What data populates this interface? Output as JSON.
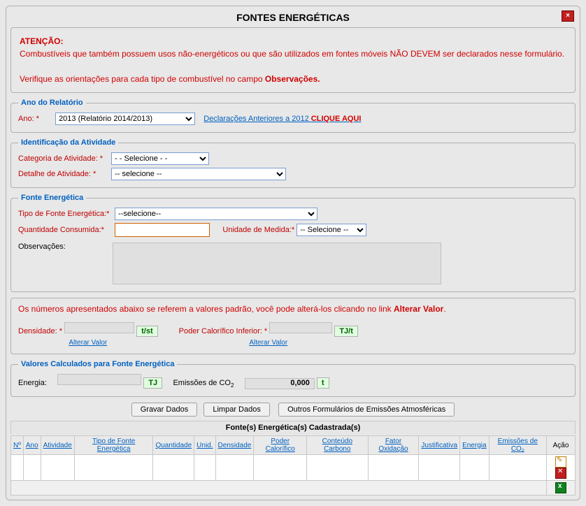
{
  "window": {
    "title": "FONTES ENERGÉTICAS",
    "close": "×"
  },
  "attention": {
    "heading": "ATENÇÃO:",
    "line1": "Combustíveis que também possuem usos não-energéticos ou que são utilizados em fontes móveis NÃO DEVEM ser declarados nesse formulário.",
    "line2a": "Verifique as orientações para cada tipo de combustível no campo ",
    "line2b": "Observações."
  },
  "ano": {
    "legend": "Ano do Relatório",
    "label": "Ano: *",
    "value": "2013 (Relatório 2014/2013)",
    "link_text": "Declarações Anteriores a 2012 ",
    "link_bold": "CLIQUE AQUI"
  },
  "ident": {
    "legend": "Identificação da Atividade",
    "categoria_label": "Categoria de Atividade: *",
    "categoria_value": "- - Selecione - -",
    "detalhe_label": "Detalhe de Atividade: *",
    "detalhe_value": "-- selecione --"
  },
  "fonte": {
    "legend": "Fonte Energética",
    "tipo_label": "Tipo de Fonte Energética:*",
    "tipo_value": "--selecione--",
    "qtd_label": "Quantidade Consumida:*",
    "qtd_value": "",
    "unid_label": "Unidade de Medida:*",
    "unid_value": "-- Selecione --",
    "obs_label": "Observações:",
    "obs_value": ""
  },
  "padrao": {
    "note_a": "Os números apresentados abaixo se referem a valores padrão, você pode alterá-los clicando no link ",
    "note_b": "Alterar Valor",
    "note_c": ".",
    "dens_label": "Densidade: *",
    "dens_value": "",
    "dens_unit": "t/st",
    "dens_link": "Alterar Valor",
    "pci_label": "Poder Calorífico Inferior: *",
    "pci_value": "",
    "pci_unit": "TJ/t",
    "pci_link": "Alterar Valor"
  },
  "calc": {
    "legend": "Valores Calculados para Fonte Energética",
    "energia_label": "Energia:",
    "energia_value": "",
    "energia_unit": "TJ",
    "emis_label_a": "Emissões de CO",
    "emis_label_b": "2",
    "emis_value": "0,000",
    "emis_unit": "t"
  },
  "buttons": {
    "gravar": "Gravar Dados",
    "limpar": "Limpar Dados",
    "outros": "Outros Formulários de Emissões Atmosféricas"
  },
  "table": {
    "title": "Fonte(s) Energética(s) Cadastrada(s)",
    "headers": [
      "Nº",
      "Ano",
      "Atividade",
      "Tipo de Fonte Energética",
      "Quantidade",
      "Unid.",
      "Densidade",
      "Poder Calorífico",
      "Conteúdo Carbono",
      "Fator Oxidação",
      "Justificativa",
      "Energia",
      "Emissões de CO₂"
    ],
    "action_header": "Ação"
  }
}
